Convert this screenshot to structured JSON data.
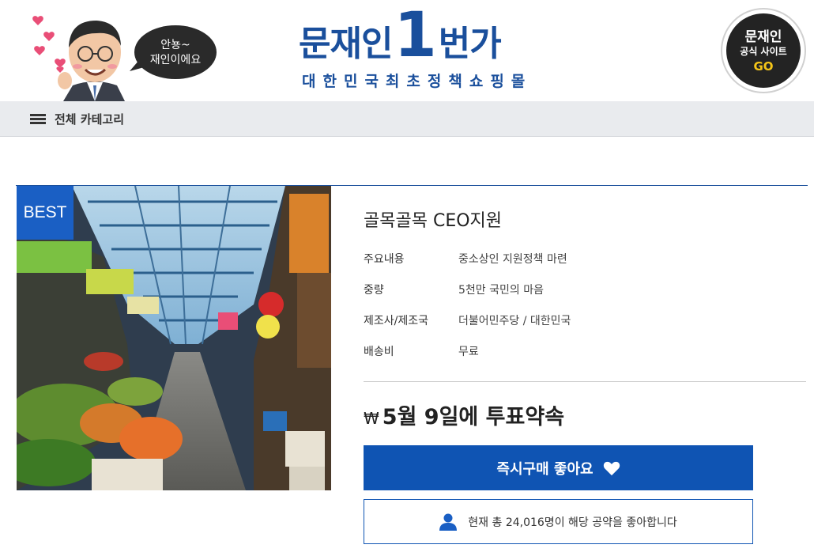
{
  "header": {
    "speech_line1": "안뇽~",
    "speech_line2": "재인이에요",
    "logo_word1": "문재인",
    "logo_one": "1",
    "logo_word2": "번가",
    "logo_tagline": "대한민국최초정책쇼핑몰",
    "site_badge": {
      "line1": "문재인",
      "line2": "공식 사이트",
      "line3": "GO"
    }
  },
  "nav": {
    "category_label": "전체 카테고리"
  },
  "product": {
    "badge": "BEST",
    "title": "골목골목 CEO지원",
    "specs": [
      {
        "label": "주요내용",
        "value": "중소상인 지원정책 마련"
      },
      {
        "label": "중량",
        "value": "5천만 국민의 마음"
      },
      {
        "label": "제조사/제조국",
        "value": "더불어민주당 / 대한민국"
      },
      {
        "label": "배송비",
        "value": "무료"
      }
    ],
    "currency_symbol": "₩",
    "price_text": "5월 9일에 투표약속",
    "buy_button_label": "즉시구매 좋아요",
    "like_count_text": "현재 총 24,016명이 해당 공약을 좋아합니다"
  },
  "colors": {
    "brand_blue": "#1a4f9c",
    "button_blue": "#0f54b3",
    "best_blue": "#1a5fc4",
    "nav_bg": "#e9ebee",
    "badge_dark": "#232323",
    "badge_gold": "#f5c518"
  }
}
